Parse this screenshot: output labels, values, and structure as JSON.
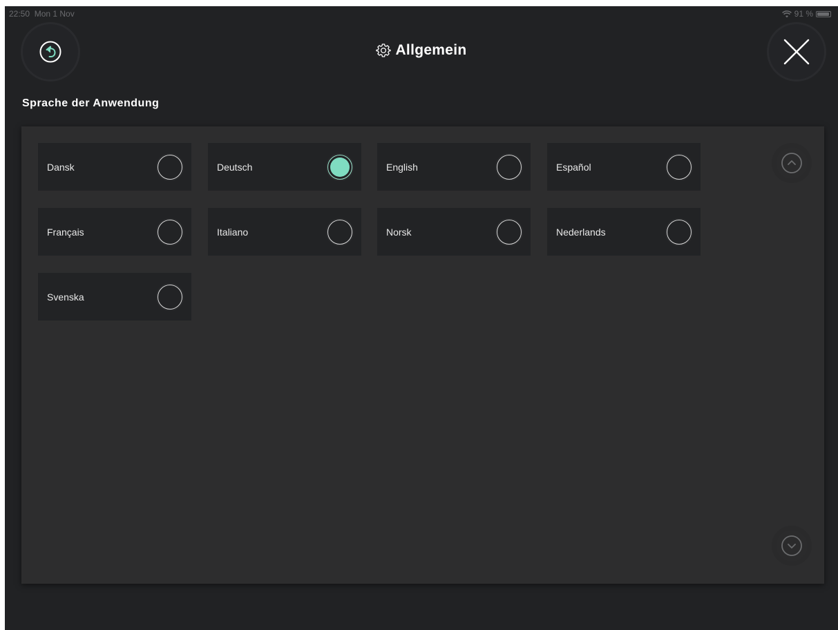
{
  "status_bar": {
    "time": "22:50",
    "date": "Mon 1 Nov",
    "battery": "91 %"
  },
  "header": {
    "title": "Allgemein",
    "title_icon": "gear-icon",
    "back_icon": "back-arrow-icon",
    "close_icon": "close-icon"
  },
  "section": {
    "label": "Sprache der Anwendung"
  },
  "languages": [
    {
      "label": "Dansk",
      "selected": false
    },
    {
      "label": "Deutsch",
      "selected": true
    },
    {
      "label": "English",
      "selected": false
    },
    {
      "label": "Español",
      "selected": false
    },
    {
      "label": "Français",
      "selected": false
    },
    {
      "label": "Italiano",
      "selected": false
    },
    {
      "label": "Norsk",
      "selected": false
    },
    {
      "label": "Nederlands",
      "selected": false
    },
    {
      "label": "Svenska",
      "selected": false
    }
  ],
  "colors": {
    "background": "#212224",
    "panel": "#2d2d2e",
    "accent": "#7fdcc1"
  }
}
